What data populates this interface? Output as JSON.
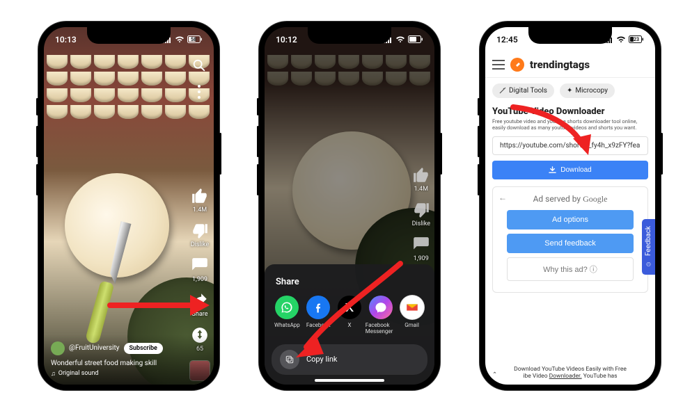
{
  "phone1": {
    "status": {
      "time": "10:13",
      "signal": "▮▮▮",
      "wifi": "wifi",
      "battery": "58"
    },
    "rail": {
      "likes": "1.4M",
      "dislike": "Dislike",
      "comments": "1,909",
      "share": "Share",
      "remix": "65"
    },
    "channel": "@FruitUniversity",
    "subscribe": "Subscribe",
    "title": "Wonderful street food making skill",
    "sound": "Original sound"
  },
  "phone2": {
    "status": {
      "time": "10:12",
      "battery": "58"
    },
    "rail": {
      "likes": "1.4M",
      "dislike": "Dislike",
      "comments": "1,909"
    },
    "share": {
      "title": "Share",
      "items": [
        {
          "label": "WhatsApp",
          "color": "#25D366",
          "glyph": "wa"
        },
        {
          "label": "Facebook",
          "color": "#1877F2",
          "glyph": "f"
        },
        {
          "label": "X",
          "color": "#000000",
          "glyph": "x"
        },
        {
          "label": "Facebook Messenger",
          "color": "#A334FA",
          "glyph": "m"
        },
        {
          "label": "Gmail",
          "color": "#ffffff",
          "glyph": "g"
        }
      ],
      "copy": "Copy link"
    }
  },
  "phone3": {
    "status": {
      "time": "12:45",
      "battery": "23"
    },
    "brand": "trendingtags",
    "chips": {
      "tools": "Digital Tools",
      "microcopy": "Microcopy"
    },
    "heading": "YouTube Video Downloader",
    "subheading": "Free youtube video and youtube shorts downloader tool online, easily download as many youtube videos and shorts you want.",
    "url_value": "https://youtube.com/shorts/_fy4h_x9zFY?fea",
    "download": "Download",
    "ad": {
      "served_prefix": "Ad served by ",
      "served_brand": "Google",
      "options": "Ad options",
      "feedback": "Send feedback",
      "why": "Why this ad? ⓘ"
    },
    "feedback_tab": "Feedback",
    "footer_line1": "Download YouTube Videos Easily with Free",
    "footer_line2_a": "ibe Video ",
    "footer_line2_b": "Downloader.",
    "footer_line2_c": " YouTube has"
  }
}
